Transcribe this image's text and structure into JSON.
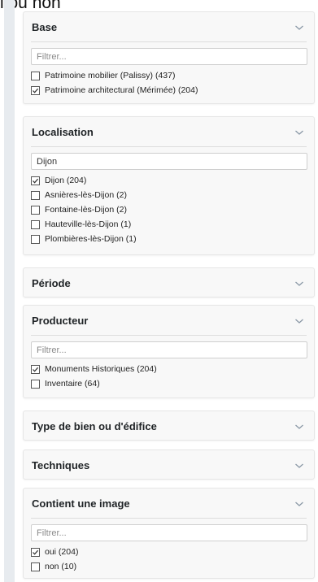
{
  "top_fragment": "i ou non",
  "check_icon": "checkmark-icon",
  "chevron_icon": "chevron-down-icon",
  "panels": [
    {
      "title": "Base",
      "filter_placeholder": "Filtrer...",
      "filter_value": "",
      "options": [
        {
          "label": "Patrimoine mobilier (Palissy) (437)",
          "checked": false
        },
        {
          "label": "Patrimoine architectural (Mérimée) (204)",
          "checked": true
        }
      ]
    },
    {
      "title": "Localisation",
      "filter_placeholder": "",
      "filter_value": "Dijon",
      "options": [
        {
          "label": "Dijon (204)",
          "checked": true
        },
        {
          "label": "Asnières-lès-Dijon (2)",
          "checked": false
        },
        {
          "label": "Fontaine-lès-Dijon (2)",
          "checked": false
        },
        {
          "label": "Hauteville-lès-Dijon (1)",
          "checked": false
        },
        {
          "label": "Plombières-lès-Dijon (1)",
          "checked": false
        }
      ]
    },
    {
      "title": "Période"
    },
    {
      "title": "Producteur",
      "filter_placeholder": "Filtrer...",
      "filter_value": "",
      "options": [
        {
          "label": "Monuments Historiques (204)",
          "checked": true
        },
        {
          "label": "Inventaire (64)",
          "checked": false
        }
      ]
    },
    {
      "title": "Type de bien ou d'édifice"
    },
    {
      "title": "Techniques"
    },
    {
      "title": "Contient une image",
      "filter_placeholder": "Filtrer...",
      "filter_value": "",
      "options": [
        {
          "label": "oui (204)",
          "checked": true
        },
        {
          "label": "non (10)",
          "checked": false
        }
      ]
    }
  ]
}
